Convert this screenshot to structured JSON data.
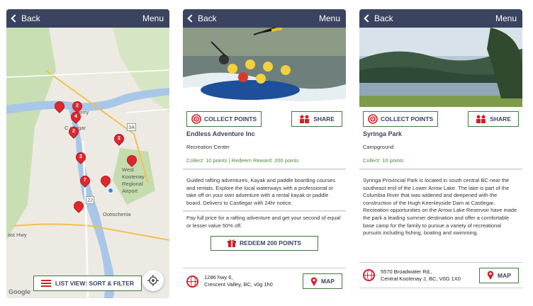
{
  "nav": {
    "back_label": "Back",
    "menu_label": "Menu"
  },
  "map_screen": {
    "labels": {
      "castlegar_a": "berry",
      "castlegar_b": "C stlegar",
      "airport_1": "West",
      "airport_2": "Kootenay",
      "airport_3": "Regional",
      "airport_4": "Airport",
      "ootischenia": "Ootischenia",
      "hwy": "ast Hwy",
      "route_3a": "3A",
      "route_22": "22",
      "google": "Google"
    },
    "pins": [
      "2",
      "4",
      "2",
      "2",
      "2",
      "",
      "7",
      "",
      ""
    ],
    "list_button_label": "LIST VIEW: SORT & FILTER"
  },
  "detail_1": {
    "collect_label": "COLLECT POINTS",
    "share_label": "SHARE",
    "title": "Endless Adventure Inc",
    "category": "Recreation Center",
    "points": "Collect: 10 points  |  Redeem Reward: 200 points",
    "description": "Guided rafting adventures, Kayak and paddle boarding courses and rentals. Explore the local waterways with a professional or take off on your own adventure with a rental kayak or paddle board. Delivers to Castlegar with 24hr notice.",
    "offer": "Pay full price for a rafting adventure and get your second of equal or lesser value 50% off.",
    "redeem_label": "REDEEM 200 POINTS",
    "address_1": "1286 hwy 6,",
    "address_2": "Crescent Valley, BC, v0g 1h0",
    "map_label": "MAP"
  },
  "detail_2": {
    "collect_label": "COLLECT POINTS",
    "share_label": "SHARE",
    "title": "Syringa Park",
    "category": "Campground",
    "points": "Collect: 10 points",
    "description": "Syringa Provincial Park is located in south central BC near the southeast end of the Lower Arrow Lake. The lake is part of the Columbia River that was widened and deepened with the construction of the Hugh Keenleyside Dam at Castlegar. Recreation opportunities on the Arrow Lake Reservoir have made the park a leading summer destination and offer a comfortable base camp for the family to pursue a variety of recreational pursuits including fishing, boating and swimming.",
    "address_1": "5570 Broadwater Rd,,",
    "address_2": "Central Kootenay J, BC, V0G 1X0",
    "map_label": "MAP"
  }
}
